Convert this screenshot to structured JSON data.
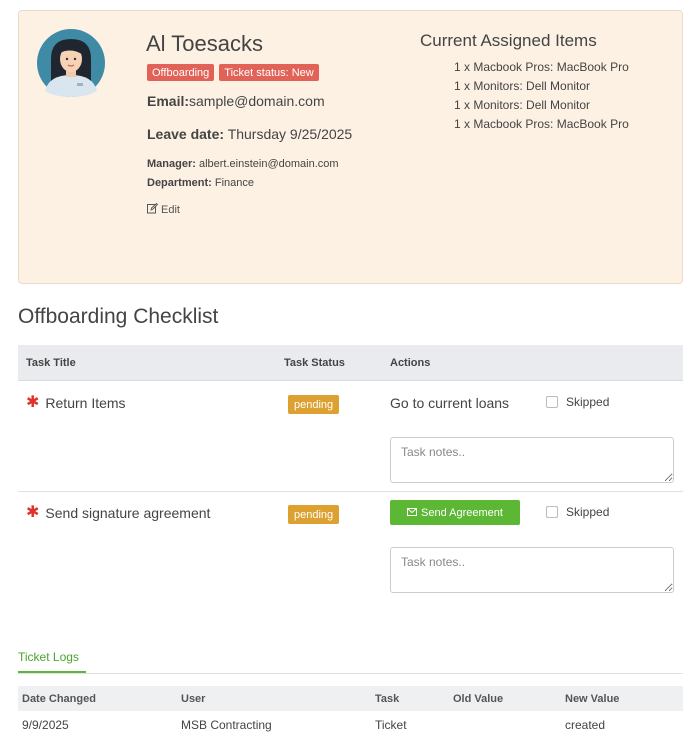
{
  "profile": {
    "name": "Al Toesacks",
    "badges": [
      "Offboarding",
      "Ticket status: New"
    ],
    "email_label": "Email:",
    "email": "sample@domain.com",
    "leave_label": "Leave date:",
    "leave_date": "Thursday 9/25/2025",
    "manager_label": "Manager:",
    "manager": "albert.einstein@domain.com",
    "department_label": "Department:",
    "department": "Finance",
    "edit_label": "Edit"
  },
  "assigned": {
    "title": "Current Assigned Items",
    "items": [
      "1 x Macbook Pros: MacBook Pro",
      "1 x Monitors: Dell Monitor",
      "1 x Monitors: Dell Monitor",
      "1 x Macbook Pros: MacBook Pro"
    ]
  },
  "checklist": {
    "title": "Offboarding Checklist",
    "headers": [
      "Task Title",
      "Task Status",
      "Actions"
    ],
    "tasks": [
      {
        "title": "Return Items",
        "status": "pending",
        "action_text": "Go to current loans",
        "skipped_label": "Skipped",
        "notes_placeholder": "Task notes.."
      },
      {
        "title": "Send signature agreement",
        "status": "pending",
        "action_button": "Send Agreement",
        "skipped_label": "Skipped",
        "notes_placeholder": "Task notes.."
      }
    ]
  },
  "logs": {
    "tab_label": "Ticket Logs",
    "headers": [
      "Date Changed",
      "User",
      "Task",
      "Old Value",
      "New Value"
    ],
    "rows": [
      [
        "9/9/2025",
        "MSB Contracting",
        "Ticket",
        "",
        "created"
      ]
    ]
  },
  "colors": {
    "card_bg": "#fdf1e4",
    "badge_red": "#e16257",
    "status_pending": "#dca131",
    "send_green": "#5cb734",
    "required_red": "#e0322a"
  }
}
